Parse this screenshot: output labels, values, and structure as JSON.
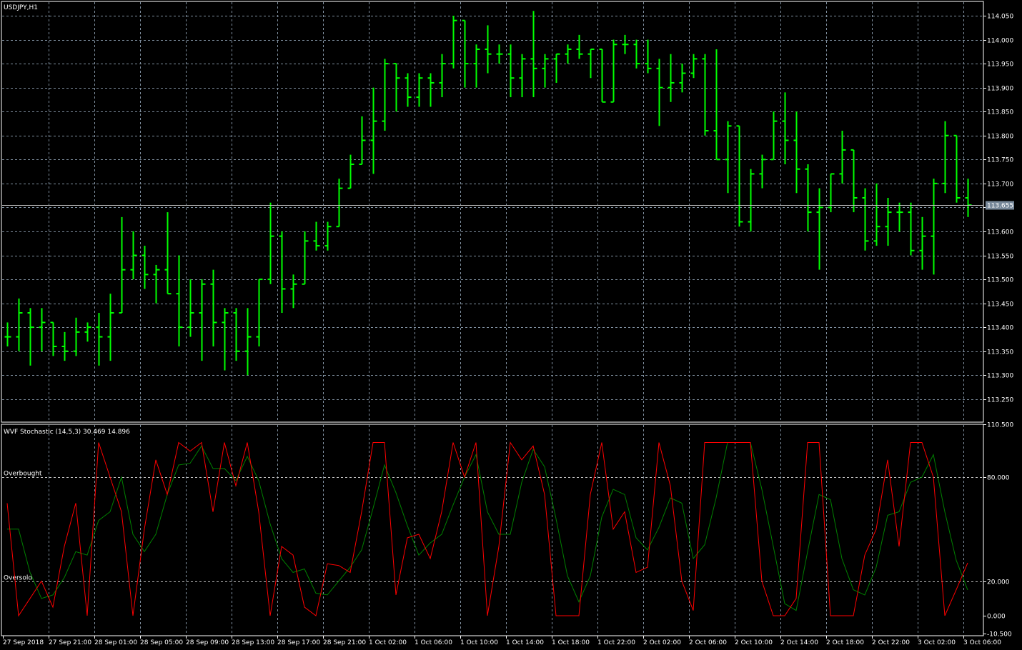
{
  "chart_data": [
    {
      "type": "ohlc",
      "title": "USDJPY,H1",
      "colors": {
        "bars": "#00ff00",
        "grid": "#8090a0",
        "bid_line": "#c0c0c0",
        "bid_label_bg": "#778899"
      },
      "current_price_label": "113.655",
      "current_price": 113.655,
      "ylim": [
        113.2,
        114.08
      ],
      "y_ticks": [
        "114.050",
        "114.000",
        "113.950",
        "113.900",
        "113.850",
        "113.800",
        "113.750",
        "113.700",
        "113.650",
        "113.600",
        "113.550",
        "113.500",
        "113.450",
        "113.400",
        "113.350",
        "113.300",
        "113.250"
      ],
      "ohlc": [
        [
          113.38,
          113.41,
          113.36,
          113.38
        ],
        [
          113.38,
          113.46,
          113.35,
          113.43
        ],
        [
          113.43,
          113.44,
          113.32,
          113.4
        ],
        [
          113.4,
          113.44,
          113.35,
          113.41
        ],
        [
          113.41,
          113.41,
          113.34,
          113.36
        ],
        [
          113.36,
          113.39,
          113.33,
          113.35
        ],
        [
          113.35,
          113.42,
          113.34,
          113.39
        ],
        [
          113.39,
          113.41,
          113.37,
          113.4
        ],
        [
          113.4,
          113.43,
          113.32,
          113.38
        ],
        [
          113.38,
          113.47,
          113.33,
          113.43
        ],
        [
          113.43,
          113.63,
          113.43,
          113.52
        ],
        [
          113.52,
          113.6,
          113.5,
          113.55
        ],
        [
          113.55,
          113.57,
          113.48,
          113.51
        ],
        [
          113.51,
          113.53,
          113.45,
          113.52
        ],
        [
          113.52,
          113.64,
          113.47,
          113.47
        ],
        [
          113.47,
          113.55,
          113.36,
          113.4
        ],
        [
          113.4,
          113.5,
          113.38,
          113.43
        ],
        [
          113.43,
          113.5,
          113.33,
          113.49
        ],
        [
          113.49,
          113.52,
          113.36,
          113.41
        ],
        [
          113.41,
          113.44,
          113.31,
          113.43
        ],
        [
          113.43,
          113.44,
          113.33,
          113.35
        ],
        [
          113.35,
          113.44,
          113.3,
          113.38
        ],
        [
          113.38,
          113.5,
          113.36,
          113.5
        ],
        [
          113.5,
          113.66,
          113.49,
          113.59
        ],
        [
          113.59,
          113.6,
          113.43,
          113.48
        ],
        [
          113.48,
          113.51,
          113.44,
          113.49
        ],
        [
          113.49,
          113.6,
          113.49,
          113.58
        ],
        [
          113.58,
          113.62,
          113.56,
          113.57
        ],
        [
          113.57,
          113.62,
          113.56,
          113.61
        ],
        [
          113.61,
          113.71,
          113.61,
          113.69
        ],
        [
          113.69,
          113.76,
          113.69,
          113.74
        ],
        [
          113.74,
          113.84,
          113.74,
          113.79
        ],
        [
          113.79,
          113.9,
          113.72,
          113.83
        ],
        [
          113.83,
          113.96,
          113.81,
          113.95
        ],
        [
          113.95,
          113.95,
          113.85,
          113.92
        ],
        [
          113.92,
          113.93,
          113.86,
          113.88
        ],
        [
          113.88,
          113.93,
          113.86,
          113.92
        ],
        [
          113.92,
          113.93,
          113.86,
          113.91
        ],
        [
          113.91,
          113.97,
          113.88,
          113.95
        ],
        [
          113.95,
          114.05,
          113.94,
          114.04
        ],
        [
          114.04,
          114.04,
          113.9,
          113.95
        ],
        [
          113.95,
          113.99,
          113.9,
          113.98
        ],
        [
          113.98,
          114.03,
          113.93,
          113.97
        ],
        [
          113.97,
          113.99,
          113.95,
          113.97
        ],
        [
          113.97,
          113.99,
          113.88,
          113.92
        ],
        [
          113.92,
          113.97,
          113.88,
          113.96
        ],
        [
          113.96,
          114.06,
          113.88,
          113.94
        ],
        [
          113.94,
          113.97,
          113.9,
          113.96
        ],
        [
          113.96,
          113.97,
          113.91,
          113.97
        ],
        [
          113.97,
          113.99,
          113.95,
          113.98
        ],
        [
          113.98,
          114.01,
          113.96,
          113.97
        ],
        [
          113.97,
          113.98,
          113.92,
          113.98
        ],
        [
          113.98,
          113.98,
          113.87,
          113.87
        ],
        [
          113.87,
          114.0,
          113.87,
          113.99
        ],
        [
          113.99,
          114.01,
          113.97,
          113.99
        ],
        [
          113.99,
          114.0,
          113.94,
          113.95
        ],
        [
          113.95,
          114.0,
          113.93,
          113.94
        ],
        [
          113.94,
          113.96,
          113.82,
          113.9
        ],
        [
          113.9,
          113.97,
          113.87,
          113.91
        ],
        [
          113.91,
          113.95,
          113.89,
          113.93
        ],
        [
          113.93,
          113.97,
          113.92,
          113.96
        ],
        [
          113.96,
          113.97,
          113.8,
          113.81
        ],
        [
          113.81,
          113.98,
          113.75,
          113.75
        ],
        [
          113.75,
          113.83,
          113.68,
          113.82
        ],
        [
          113.82,
          113.82,
          113.61,
          113.62
        ],
        [
          113.62,
          113.73,
          113.6,
          113.72
        ],
        [
          113.72,
          113.76,
          113.69,
          113.75
        ],
        [
          113.75,
          113.85,
          113.75,
          113.83
        ],
        [
          113.83,
          113.89,
          113.74,
          113.79
        ],
        [
          113.79,
          113.85,
          113.68,
          113.73
        ],
        [
          113.73,
          113.74,
          113.6,
          113.64
        ],
        [
          113.64,
          113.69,
          113.52,
          113.65
        ],
        [
          113.65,
          113.72,
          113.64,
          113.72
        ],
        [
          113.72,
          113.81,
          113.7,
          113.77
        ],
        [
          113.77,
          113.77,
          113.64,
          113.67
        ],
        [
          113.67,
          113.69,
          113.56,
          113.58
        ],
        [
          113.58,
          113.7,
          113.57,
          113.61
        ],
        [
          113.61,
          113.67,
          113.57,
          113.64
        ],
        [
          113.64,
          113.66,
          113.6,
          113.64
        ],
        [
          113.64,
          113.66,
          113.55,
          113.56
        ],
        [
          113.56,
          113.63,
          113.52,
          113.59
        ],
        [
          113.59,
          113.71,
          113.51,
          113.7
        ],
        [
          113.7,
          113.83,
          113.68,
          113.8
        ],
        [
          113.8,
          113.8,
          113.66,
          113.67
        ],
        [
          113.67,
          113.71,
          113.63,
          113.655
        ]
      ]
    },
    {
      "type": "line",
      "title": "WVF Stochastic (14,5,3) 30.469 14.896",
      "ylim": [
        -10.5,
        110.5
      ],
      "y_ticks": [
        "110.500",
        "80.000",
        "20.000",
        "0.000",
        "-10.500"
      ],
      "levels": [
        {
          "label": "Overbought",
          "value": 80
        },
        {
          "label": "Oversold",
          "value": 20
        }
      ],
      "series": [
        {
          "name": "main",
          "color": "#ff0000",
          "values": [
            65,
            0,
            10,
            20,
            5,
            40,
            65,
            0,
            100,
            80,
            60,
            0,
            50,
            90,
            70,
            100,
            95,
            100,
            60,
            100,
            75,
            100,
            60,
            0,
            40,
            35,
            5,
            0,
            30,
            29,
            25,
            60,
            100,
            100,
            12,
            45,
            47,
            33,
            60,
            100,
            80,
            100,
            0,
            40,
            100,
            90,
            98,
            70,
            0,
            0,
            0,
            70,
            100,
            50,
            60,
            25,
            28,
            100,
            75,
            20,
            3,
            100,
            100,
            100,
            100,
            100,
            20,
            0,
            0,
            10,
            100,
            100,
            0,
            0,
            0,
            35,
            50,
            90,
            40,
            100,
            100,
            80,
            0,
            15,
            30.469
          ]
        },
        {
          "name": "signal",
          "color": "#008000",
          "values": [
            50,
            50,
            25,
            10,
            12,
            22,
            37,
            35,
            55,
            60,
            80,
            47,
            37,
            47,
            70,
            87,
            88,
            98,
            85,
            85,
            78,
            92,
            78,
            53,
            33,
            25,
            27,
            13,
            12,
            20,
            28,
            38,
            62,
            87,
            71,
            52,
            35,
            42,
            47,
            64,
            80,
            93,
            60,
            47,
            47,
            77,
            96,
            86,
            56,
            23,
            8,
            23,
            57,
            73,
            70,
            45,
            38,
            51,
            68,
            65,
            33,
            41,
            68,
            100,
            100,
            100,
            73,
            40,
            7,
            3,
            37,
            70,
            67,
            33,
            15,
            12,
            28,
            58,
            60,
            77,
            80,
            93,
            60,
            32,
            14.896
          ]
        }
      ]
    }
  ],
  "time_axis": [
    "27 Sep 2018",
    "27 Sep 21:00",
    "28 Sep 01:00",
    "28 Sep 05:00",
    "28 Sep 09:00",
    "28 Sep 13:00",
    "28 Sep 17:00",
    "28 Sep 21:00",
    "1 Oct 02:00",
    "1 Oct 06:00",
    "1 Oct 10:00",
    "1 Oct 14:00",
    "1 Oct 18:00",
    "1 Oct 22:00",
    "2 Oct 02:00",
    "2 Oct 06:00",
    "2 Oct 10:00",
    "2 Oct 14:00",
    "2 Oct 18:00",
    "2 Oct 22:00",
    "3 Oct 02:00",
    "3 Oct 06:00"
  ]
}
